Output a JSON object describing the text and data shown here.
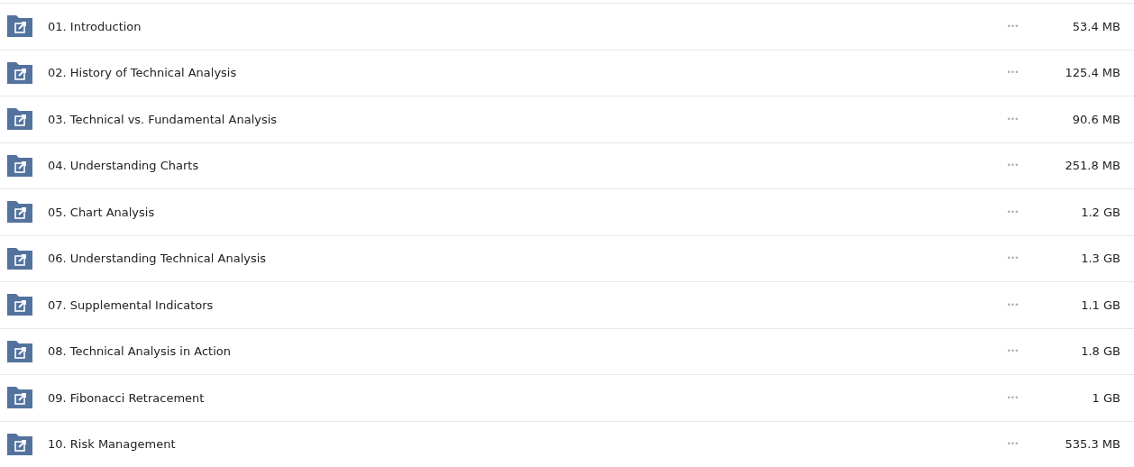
{
  "folders": [
    {
      "name": "01. Introduction",
      "more": "•••",
      "size": "53.4 MB"
    },
    {
      "name": "02. History of Technical Analysis",
      "more": "•••",
      "size": "125.4 MB"
    },
    {
      "name": "03. Technical vs. Fundamental Analysis",
      "more": "•••",
      "size": "90.6 MB"
    },
    {
      "name": "04. Understanding Charts",
      "more": "•••",
      "size": "251.8 MB"
    },
    {
      "name": "05. Chart Analysis",
      "more": "•••",
      "size": "1.2 GB"
    },
    {
      "name": "06. Understanding Technical Analysis",
      "more": "•••",
      "size": "1.3 GB"
    },
    {
      "name": "07. Supplemental Indicators",
      "more": "•••",
      "size": "1.1 GB"
    },
    {
      "name": "08. Technical Analysis in Action",
      "more": "•••",
      "size": "1.8 GB"
    },
    {
      "name": "09. Fibonacci Retracement",
      "more": "•••",
      "size": "1 GB"
    },
    {
      "name": "10. Risk Management",
      "more": "•••",
      "size": "535.3 MB"
    }
  ]
}
